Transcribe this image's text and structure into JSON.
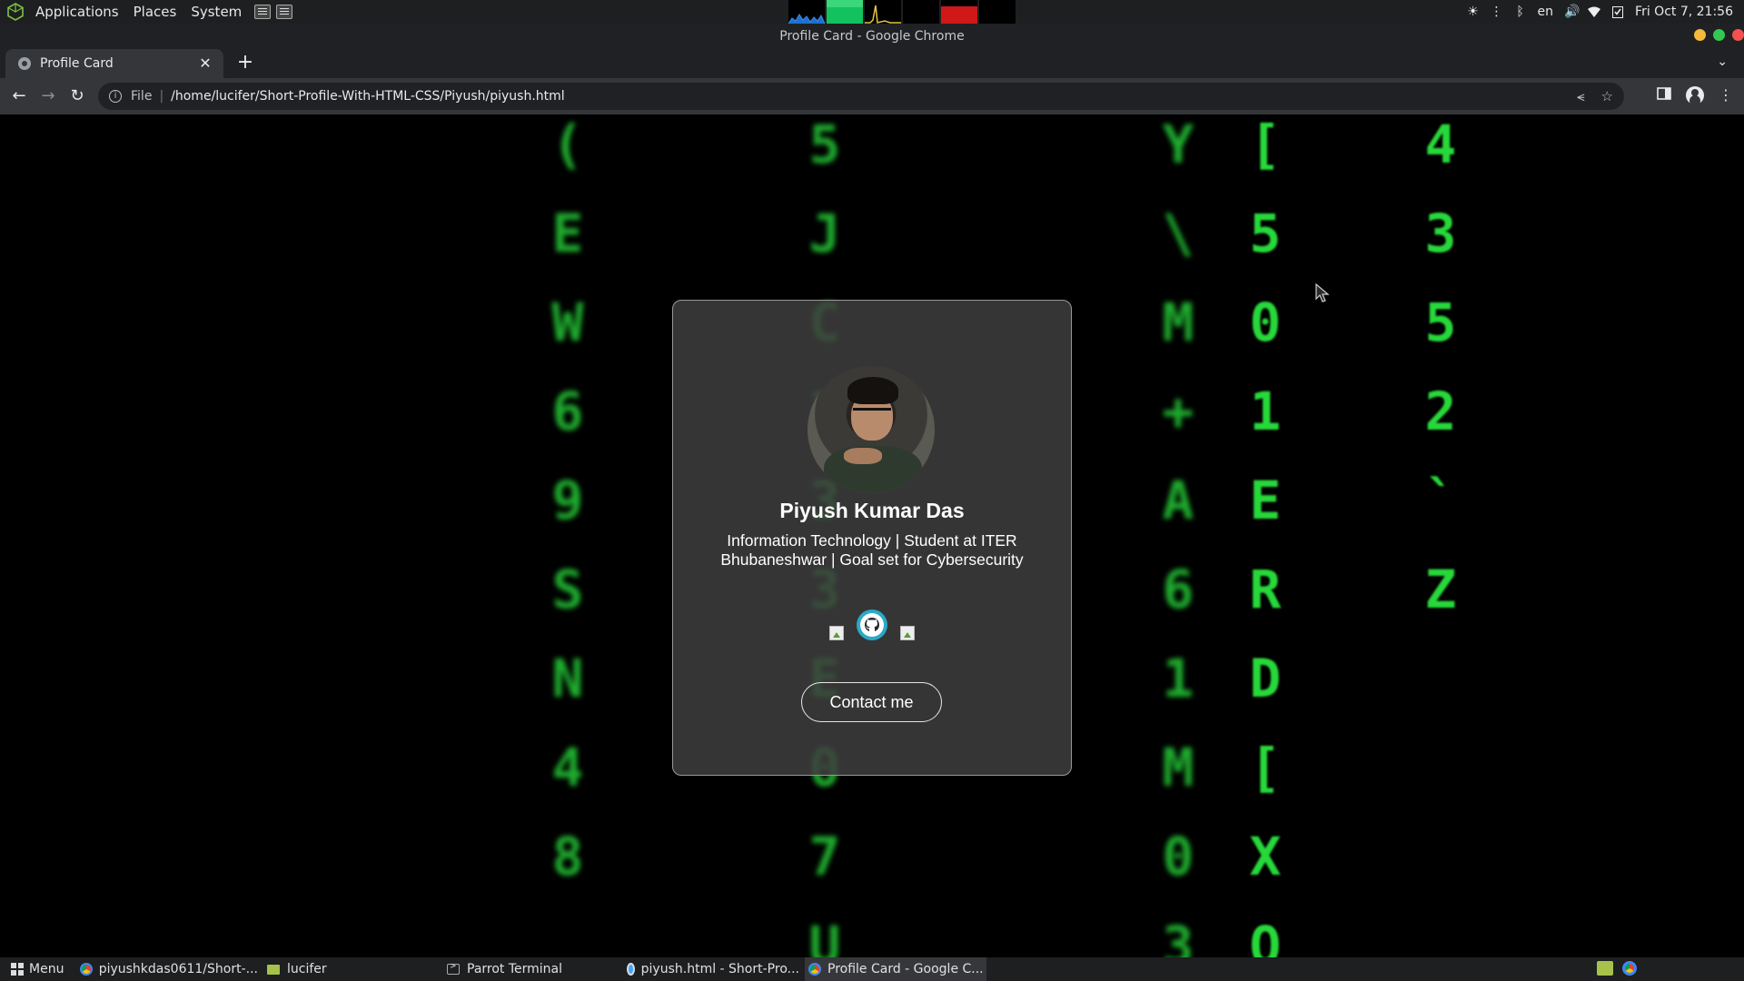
{
  "system_panel": {
    "menus": [
      "Applications",
      "Places",
      "System"
    ],
    "lang": "en",
    "datetime": "Fri Oct 7, 21:56",
    "colors": {
      "mon_cpu": "#1e6fd0",
      "mon_mem": "#12c25c",
      "mon_net": "#e3c53c",
      "mon_disk": "#d01818"
    }
  },
  "window": {
    "title": "Profile Card - Google Chrome",
    "colors": {
      "close": "#f2524d",
      "minimize": "#f6b93b",
      "maximize": "#31c950"
    }
  },
  "browser": {
    "tab": {
      "label": "Profile Card",
      "close_icon": "close-icon"
    },
    "new_tab_label": "+",
    "address": {
      "scheme": "File",
      "url": "/home/lucifer/Short-Profile-With-HTML-CSS/Piyush/piyush.html"
    }
  },
  "page": {
    "background_glyphs": [
      [
        "(",
        "E",
        "W",
        "6",
        "9",
        "S",
        "N",
        "4",
        "8"
      ],
      [
        "5",
        "J",
        "C",
        "3",
        "3",
        "3",
        "E",
        "0",
        "7",
        "U"
      ],
      [
        "4",
        "3",
        "5",
        "2",
        "`",
        "",
        "Z"
      ],
      [
        "[",
        "5",
        "0",
        "1",
        "E",
        "R",
        "D",
        "[",
        "X",
        "O"
      ],
      [
        "Y",
        "\\",
        "M",
        "+",
        "A",
        "6",
        "1",
        "M",
        "0",
        "3"
      ]
    ],
    "profile": {
      "name": "Piyush Kumar Das",
      "bio": "Information Technology | Student at ITER Bhubaneshwar | Goal set for Cybersecurity",
      "contact_label": "Contact me",
      "social_icons": [
        "broken-image-icon",
        "github-icon",
        "broken-image-icon"
      ]
    }
  },
  "taskbar": {
    "menu_label": "Menu",
    "items": [
      {
        "label": "piyushkdas0611/Short-...",
        "icon": "chrome-icon"
      },
      {
        "label": "lucifer",
        "icon": "folder-icon"
      },
      {
        "label": "Parrot Terminal",
        "icon": "terminal-icon"
      },
      {
        "label": "piyush.html - Short-Pro...",
        "icon": "vscode-icon"
      },
      {
        "label": "Profile Card - Google C...",
        "icon": "chrome-icon"
      }
    ]
  }
}
